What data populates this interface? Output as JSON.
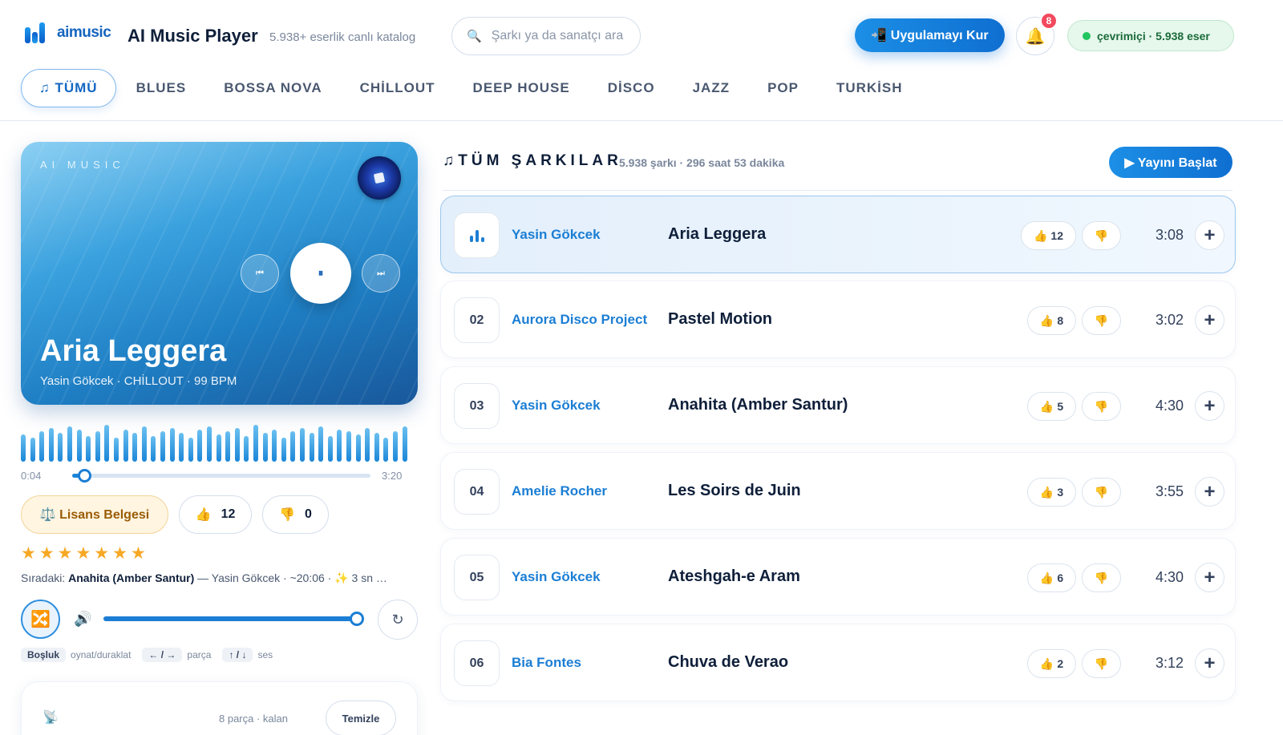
{
  "header": {
    "logo_text": "aimusic",
    "app_title": "AI Music Player",
    "app_subtitle": "5.938+ eserlik canlı katalog",
    "search_placeholder": "Şarkı ya da sanatçı ara",
    "install_label": "📲 Uygulamayı Kur",
    "notification_count": "8",
    "online_status": "çevrimiçi · 5.938 eser",
    "colors": {
      "accent": "#1b7ed4",
      "badge": "#f2495e",
      "online": "#22c55e"
    }
  },
  "genres": [
    {
      "label": "♫ TÜMÜ",
      "active": true
    },
    {
      "label": "BLUES"
    },
    {
      "label": "BOSSA NOVA"
    },
    {
      "label": "CHİLLOUT"
    },
    {
      "label": "DEEP HOUSE"
    },
    {
      "label": "DİSCO"
    },
    {
      "label": "JAZZ"
    },
    {
      "label": "POP"
    },
    {
      "label": "TURKİSH"
    }
  ],
  "player": {
    "brand": "AI MUSIC",
    "title": "Aria Leggera",
    "meta": "Yasin Gökcek · CHİLLOUT · 99 BPM",
    "prev_icon": "⏮",
    "pause_icon": "⏸",
    "next_icon": "⏭",
    "elapsed": "0:04",
    "total": "3:20",
    "progress": 0.02,
    "license_label": "⚖️ Lisans Belgesi",
    "likes": "12",
    "dislikes": "0",
    "stars": "★★★★★★★",
    "next_label": "Sıradaki:",
    "next_title": "Anahita (Amber Santur)",
    "next_rest": " — Yasin Gökcek · ~20:06 · ✨ 3 sn …",
    "volume": 1.0,
    "hints": {
      "space_key": "Boşluk",
      "space_desc": "oynat/duraklat",
      "track_keys": "← / →",
      "track_desc": "parça",
      "vol_keys": "↑ / ↓",
      "vol_desc": "ses"
    }
  },
  "queue": {
    "count_label": "8 parça · kalan",
    "clear_label": "Temizle"
  },
  "list": {
    "title": "♫TÜM ŞARKILAR",
    "subtitle": "5.938 şarkı · 296 saat 53 dakika",
    "start_label": "▶ Yayını Başlat",
    "songs": [
      {
        "num": "",
        "playing": true,
        "artist": "Yasin Gökcek",
        "title": "Aria Leggera",
        "likes": "12",
        "duration": "3:08"
      },
      {
        "num": "02",
        "artist": "Aurora Disco Project",
        "title": "Pastel Motion",
        "likes": "8",
        "duration": "3:02"
      },
      {
        "num": "03",
        "artist": "Yasin Gökcek",
        "title": "Anahita (Amber Santur)",
        "likes": "5",
        "duration": "4:30"
      },
      {
        "num": "04",
        "artist": "Amelie Rocher",
        "title": "Les Soirs de Juin",
        "likes": "3",
        "duration": "3:55"
      },
      {
        "num": "05",
        "artist": "Yasin Gökcek",
        "title": "Ateshgah-e Aram",
        "likes": "6",
        "duration": "4:30"
      },
      {
        "num": "06",
        "artist": "Bia Fontes",
        "title": "Chuva de Verao",
        "likes": "2",
        "duration": "3:12"
      }
    ]
  }
}
